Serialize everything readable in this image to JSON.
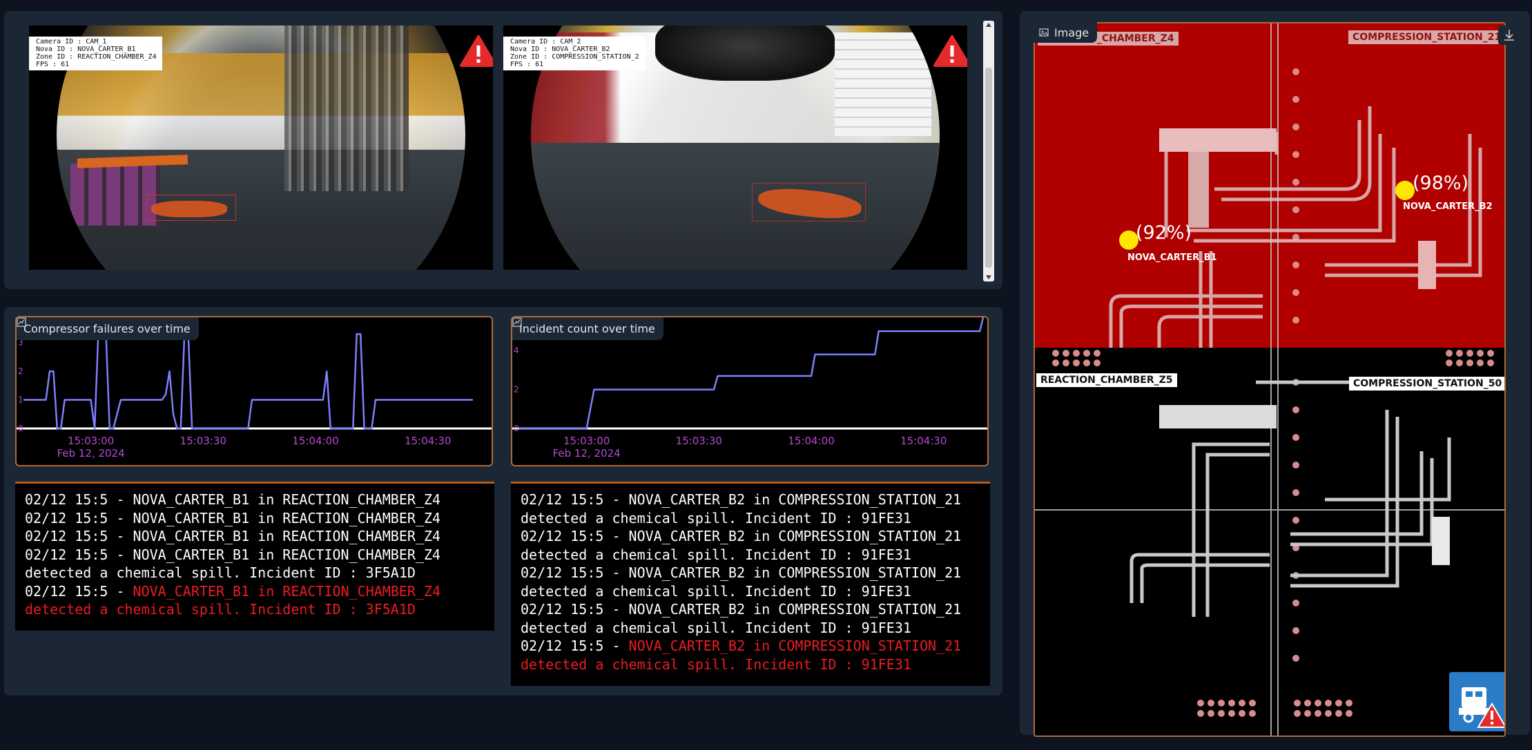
{
  "cameras": [
    {
      "camera_id": "Camera ID : CAM_1",
      "nova_id": "Nova ID : NOVA_CARTER_B1",
      "zone_id": "Zone ID : REACTION_CHAMBER_Z4",
      "fps": "FPS : 61",
      "alert_icon": "warning-icon"
    },
    {
      "camera_id": "Camera ID : CAM_2",
      "nova_id": "Nova ID : NOVA_CARTER_B2",
      "zone_id": "Zone ID : COMPRESSION_STATION_2",
      "fps": "FPS : 61",
      "alert_icon": "warning-icon"
    }
  ],
  "charts": {
    "compressor": {
      "title": "Compressor failures over time",
      "icon": "chart-icon"
    },
    "incident": {
      "title": "Incident count over time",
      "icon": "chart-icon"
    }
  },
  "chart_data": [
    {
      "type": "line",
      "title": "Compressor failures over time",
      "x_ticks": [
        "15:03:00",
        "15:03:30",
        "15:04:00",
        "15:04:30"
      ],
      "date_label": "Feb 12, 2024",
      "y_ticks": [
        "0",
        "1",
        "2",
        "3"
      ],
      "ylim": [
        0,
        3.4
      ],
      "line_color": "#7f7fff",
      "series": [
        {
          "x": [
            "15:02:42",
            "15:02:48",
            "15:02:49",
            "15:02:50",
            "15:02:51",
            "15:02:52",
            "15:02:53",
            "15:03:00",
            "15:03:01",
            "15:03:02",
            "15:03:04",
            "15:03:05",
            "15:03:06",
            "15:03:08",
            "15:03:09",
            "15:03:10",
            "15:03:19",
            "15:03:20",
            "15:03:21",
            "15:03:22",
            "15:03:23",
            "15:03:24",
            "15:03:25",
            "15:03:26",
            "15:03:27",
            "15:03:28",
            "15:03:41",
            "15:03:42",
            "15:03:43",
            "15:03:44",
            "15:03:45",
            "15:03:46",
            "15:03:47",
            "15:03:50",
            "15:03:51",
            "15:03:52",
            "15:04:02",
            "15:04:03",
            "15:04:04",
            "15:04:05",
            "15:04:06",
            "15:04:09",
            "15:04:10",
            "15:04:11",
            "15:04:12",
            "15:04:13",
            "15:04:14",
            "15:04:15",
            "15:04:16",
            "15:04:17",
            "15:04:18",
            "15:04:20",
            "15:04:21",
            "15:04:42"
          ],
          "y": [
            1,
            1,
            2,
            2,
            0,
            0,
            1,
            1,
            0,
            3.4,
            3.4,
            0,
            0,
            1,
            1,
            1,
            1,
            1.2,
            2,
            0.5,
            0,
            0,
            3.3,
            3.3,
            0,
            0,
            0,
            0,
            1,
            1,
            1,
            1,
            1,
            1,
            1,
            1,
            1,
            2,
            0,
            0,
            0,
            0,
            0,
            3.3,
            3.3,
            0,
            0,
            0,
            1,
            1,
            1,
            1,
            1,
            1
          ]
        }
      ]
    },
    {
      "type": "line",
      "title": "Incident count over time",
      "x_ticks": [
        "15:03:00",
        "15:03:30",
        "15:04:00",
        "15:04:30"
      ],
      "date_label": "Feb 12, 2024",
      "y_ticks": [
        "0",
        "2",
        "4"
      ],
      "ylim": [
        0,
        5
      ],
      "line_color": "#7f7fff",
      "series": [
        {
          "x": [
            "15:02:42",
            "15:02:59",
            "15:03:00",
            "15:03:02",
            "15:03:34",
            "15:03:35",
            "15:03:36",
            "15:04:00",
            "15:04:01",
            "15:04:17",
            "15:04:18",
            "15:04:45",
            "15:04:46"
          ],
          "y": [
            0,
            0,
            0,
            2,
            2,
            2.7,
            2.7,
            2.7,
            3.8,
            3.8,
            5,
            5,
            5.8
          ]
        }
      ]
    }
  ],
  "logs": {
    "left": [
      {
        "text": "02/12 15:5 - NOVA_CARTER_B1 in REACTION_CHAMBER_Z4",
        "alert": false
      },
      {
        "text": "02/12 15:5 - NOVA_CARTER_B1 in REACTION_CHAMBER_Z4",
        "alert": false
      },
      {
        "text": "02/12 15:5 - NOVA_CARTER_B1 in REACTION_CHAMBER_Z4",
        "alert": false
      },
      {
        "text": "02/12 15:5 - NOVA_CARTER_B1 in REACTION_CHAMBER_Z4",
        "alert": false
      },
      {
        "text": "detected a chemical spill. Incident ID : 3F5A1D",
        "alert": false
      },
      {
        "prefix": "02/12 15:5 - ",
        "text": "NOVA_CARTER_B1 in REACTION_CHAMBER_Z4",
        "alert": true
      },
      {
        "text": "detected a chemical spill. Incident ID : 3F5A1D",
        "alert": true
      }
    ],
    "right": [
      {
        "text": "02/12 15:5 - NOVA_CARTER_B2 in COMPRESSION_STATION_21",
        "alert": false
      },
      {
        "text": "detected a chemical spill. Incident ID : 91FE31",
        "alert": false
      },
      {
        "text": "02/12 15:5 - NOVA_CARTER_B2 in COMPRESSION_STATION_21",
        "alert": false
      },
      {
        "text": "detected a chemical spill. Incident ID : 91FE31",
        "alert": false
      },
      {
        "text": "02/12 15:5 - NOVA_CARTER_B2 in COMPRESSION_STATION_21",
        "alert": false
      },
      {
        "text": "detected a chemical spill. Incident ID : 91FE31",
        "alert": false
      },
      {
        "text": "02/12 15:5 - NOVA_CARTER_B2 in COMPRESSION_STATION_21",
        "alert": false
      },
      {
        "text": "detected a chemical spill. Incident ID : 91FE31",
        "alert": false
      },
      {
        "prefix": "02/12 15:5 - ",
        "text": "NOVA_CARTER_B2 in COMPRESSION_STATION_21",
        "alert": true
      },
      {
        "text": "detected a chemical spill. Incident ID : 91FE31",
        "alert": true
      }
    ]
  },
  "map": {
    "title": "Image",
    "icon": "image-icon",
    "download_icon": "download-icon",
    "zones": {
      "reaction_z4": "REACTION_CHAMBER_Z4",
      "compression_top": "COMPRESSION_STATION_21",
      "reaction_z5": "REACTION_CHAMBER_Z5",
      "compression_50": "COMPRESSION_STATION_50"
    },
    "robots": [
      {
        "name": "NOVA_CARTER_B1",
        "confidence": "(92%)"
      },
      {
        "name": "NOVA_CARTER_B2",
        "confidence": "(98%)"
      }
    ],
    "alert_button_icon": "robot-alert-icon",
    "colors": {
      "alert_zone": "#b00000",
      "robot": "#ffe600",
      "alert_text": "#ec1c24",
      "series": "#7f7fff"
    }
  }
}
